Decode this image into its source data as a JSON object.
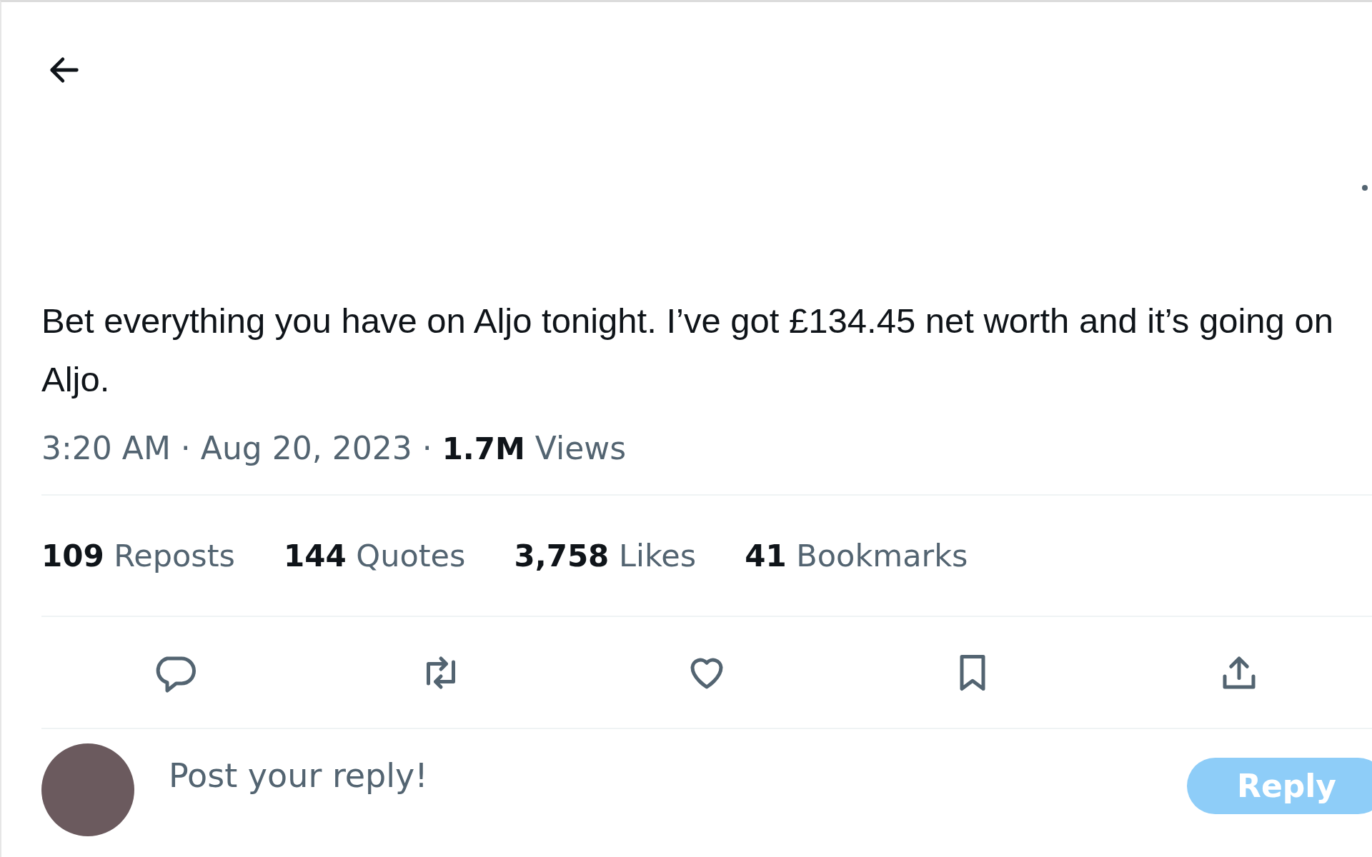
{
  "tweet": {
    "text": "Bet everything you have on Aljo tonight. I’ve got £134.45 net worth and it’s going on Aljo.",
    "time": "3:20 AM",
    "separator": "·",
    "date": "Aug 20, 2023",
    "views_count": "1.7M",
    "views_label": "Views"
  },
  "stats": [
    {
      "count": "109",
      "label": "Reposts"
    },
    {
      "count": "144",
      "label": "Quotes"
    },
    {
      "count": "3,758",
      "label": "Likes"
    },
    {
      "count": "41",
      "label": "Bookmarks"
    }
  ],
  "actions": [
    {
      "kind": "reply"
    },
    {
      "kind": "repost"
    },
    {
      "kind": "like"
    },
    {
      "kind": "bookmark"
    },
    {
      "kind": "share"
    }
  ],
  "composer": {
    "placeholder": "Post your reply!",
    "button": "Reply"
  }
}
